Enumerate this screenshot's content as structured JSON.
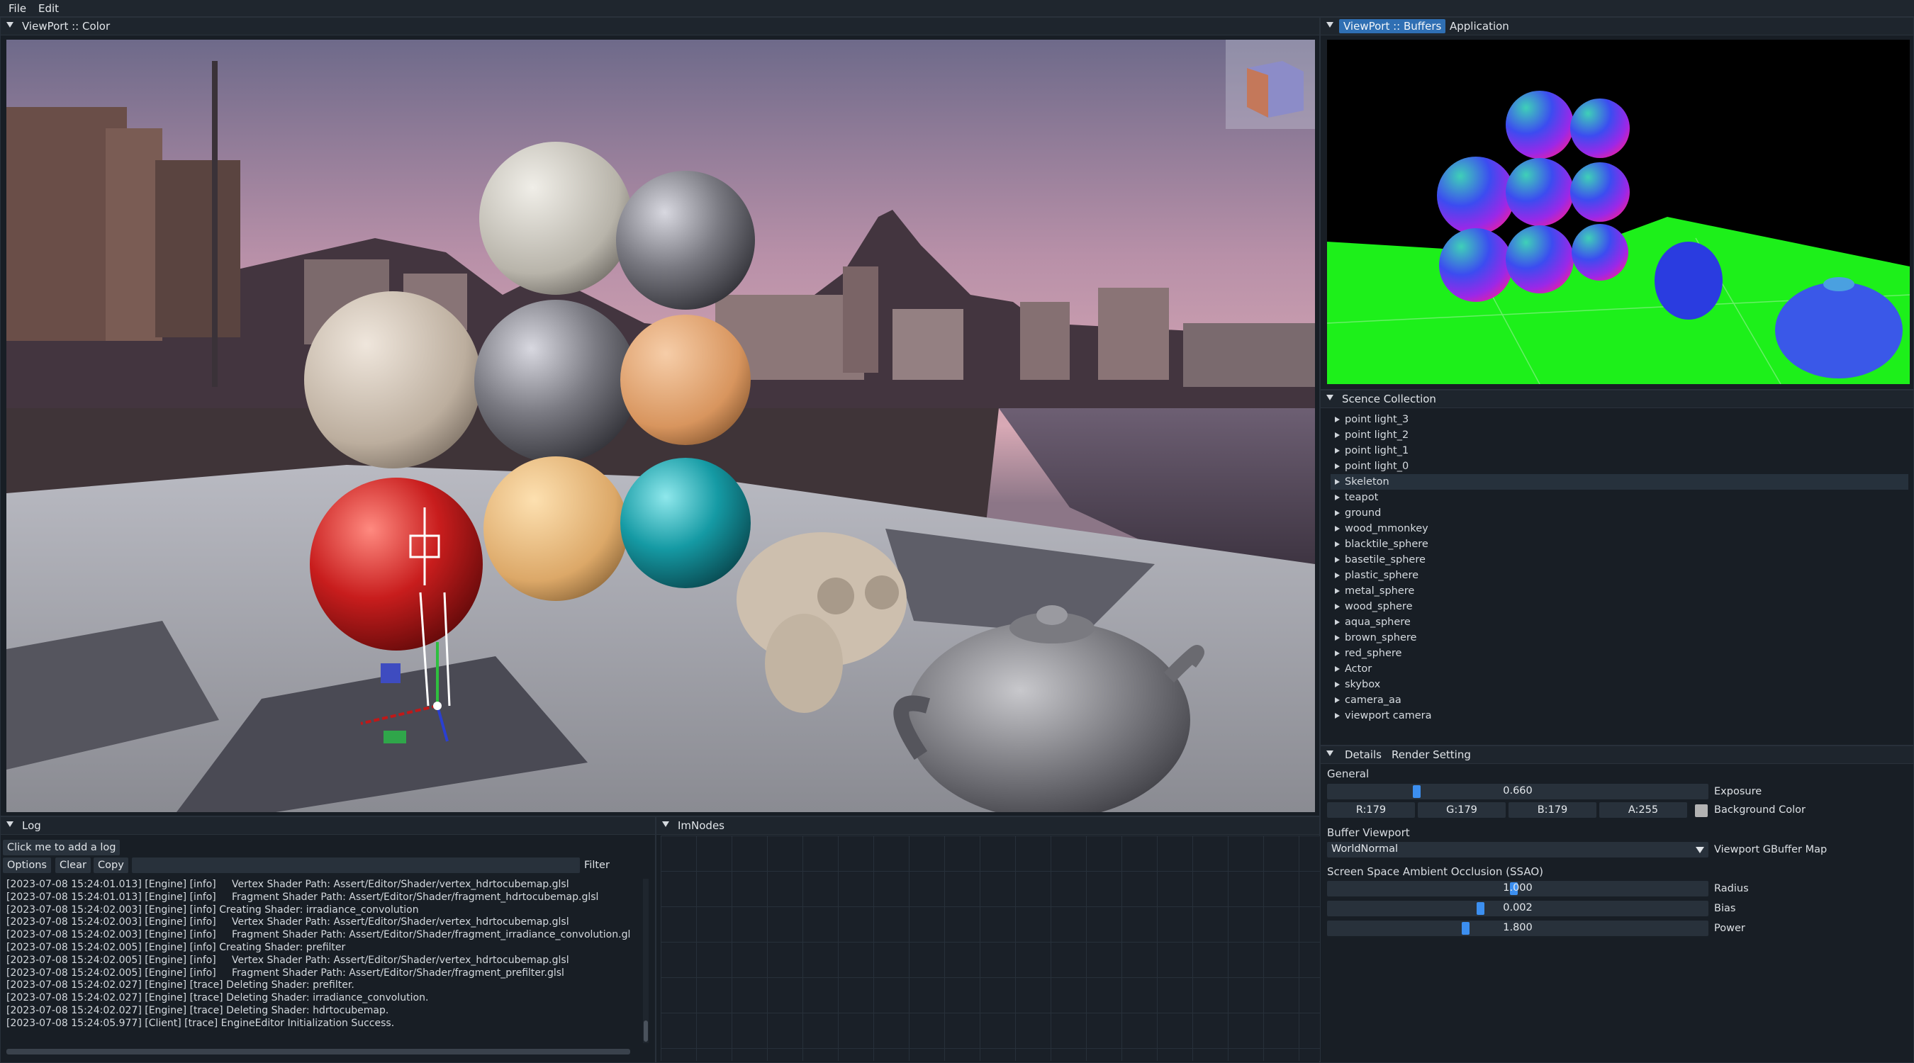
{
  "menu": {
    "items": [
      "File",
      "Edit"
    ]
  },
  "viewport_main": {
    "title": "ViewPort :: Color"
  },
  "buffers_panel": {
    "tabs": [
      "ViewPort :: Buffers",
      "Application"
    ],
    "active_tab": "ViewPort :: Buffers"
  },
  "scene": {
    "title": "Scence Collection",
    "selected": "Skeleton",
    "items": [
      "point light_3",
      "point light_2",
      "point light_1",
      "point light_0",
      "Skeleton",
      "teapot",
      "ground",
      "wood_mmonkey",
      "blacktile_sphere",
      "basetile_sphere",
      "plastic_sphere",
      "metal_sphere",
      "wood_sphere",
      "aqua_sphere",
      "brown_sphere",
      "red_sphere",
      "Actor",
      "skybox",
      "camera_aa",
      "viewport camera"
    ]
  },
  "details": {
    "tabs": [
      "Details",
      "Render Setting"
    ],
    "general_label": "General",
    "exposure": {
      "value": "0.660",
      "label": "Exposure",
      "fraction": 0.23
    },
    "background_color": {
      "r": "R:179",
      "g": "G:179",
      "b": "B:179",
      "a": "A:255",
      "label": "Background Color",
      "swatch": "#b3b3b3"
    },
    "buffer_label": "Buffer Viewport",
    "gbuffer": {
      "value": "WorldNormal",
      "label": "Viewport GBuffer Map"
    },
    "ssao_label": "Screen Space Ambient Occlusion (SSAO)",
    "radius": {
      "value": "1.000",
      "label": "Radius",
      "fraction": 0.49
    },
    "bias": {
      "value": "0.002",
      "label": "Bias",
      "fraction": 0.4
    },
    "power": {
      "value": "1.800",
      "label": "Power",
      "fraction": 0.36
    }
  },
  "log": {
    "title": "Log",
    "add_button": "Click me to add a log",
    "options_button": "Options",
    "clear_button": "Clear",
    "copy_button": "Copy",
    "filter_label": "Filter",
    "filter_value": "",
    "lines": [
      "[2023-07-08 15:24:01.013] [Engine] [info]     Vertex Shader Path: Assert/Editor/Shader/vertex_hdrtocubemap.glsl",
      "[2023-07-08 15:24:01.013] [Engine] [info]     Fragment Shader Path: Assert/Editor/Shader/fragment_hdrtocubemap.glsl",
      "[2023-07-08 15:24:02.003] [Engine] [info] Creating Shader: irradiance_convolution",
      "[2023-07-08 15:24:02.003] [Engine] [info]     Vertex Shader Path: Assert/Editor/Shader/vertex_hdrtocubemap.glsl",
      "[2023-07-08 15:24:02.003] [Engine] [info]     Fragment Shader Path: Assert/Editor/Shader/fragment_irradiance_convolution.gl",
      "[2023-07-08 15:24:02.005] [Engine] [info] Creating Shader: prefilter",
      "[2023-07-08 15:24:02.005] [Engine] [info]     Vertex Shader Path: Assert/Editor/Shader/vertex_hdrtocubemap.glsl",
      "[2023-07-08 15:24:02.005] [Engine] [info]     Fragment Shader Path: Assert/Editor/Shader/fragment_prefilter.glsl",
      "[2023-07-08 15:24:02.027] [Engine] [trace] Deleting Shader: prefilter.",
      "[2023-07-08 15:24:02.027] [Engine] [trace] Deleting Shader: irradiance_convolution.",
      "[2023-07-08 15:24:02.027] [Engine] [trace] Deleting Shader: hdrtocubemap.",
      "[2023-07-08 15:24:05.977] [Client] [trace] EngineEditor Initialization Success."
    ]
  },
  "imnodes": {
    "title": "ImNodes"
  }
}
